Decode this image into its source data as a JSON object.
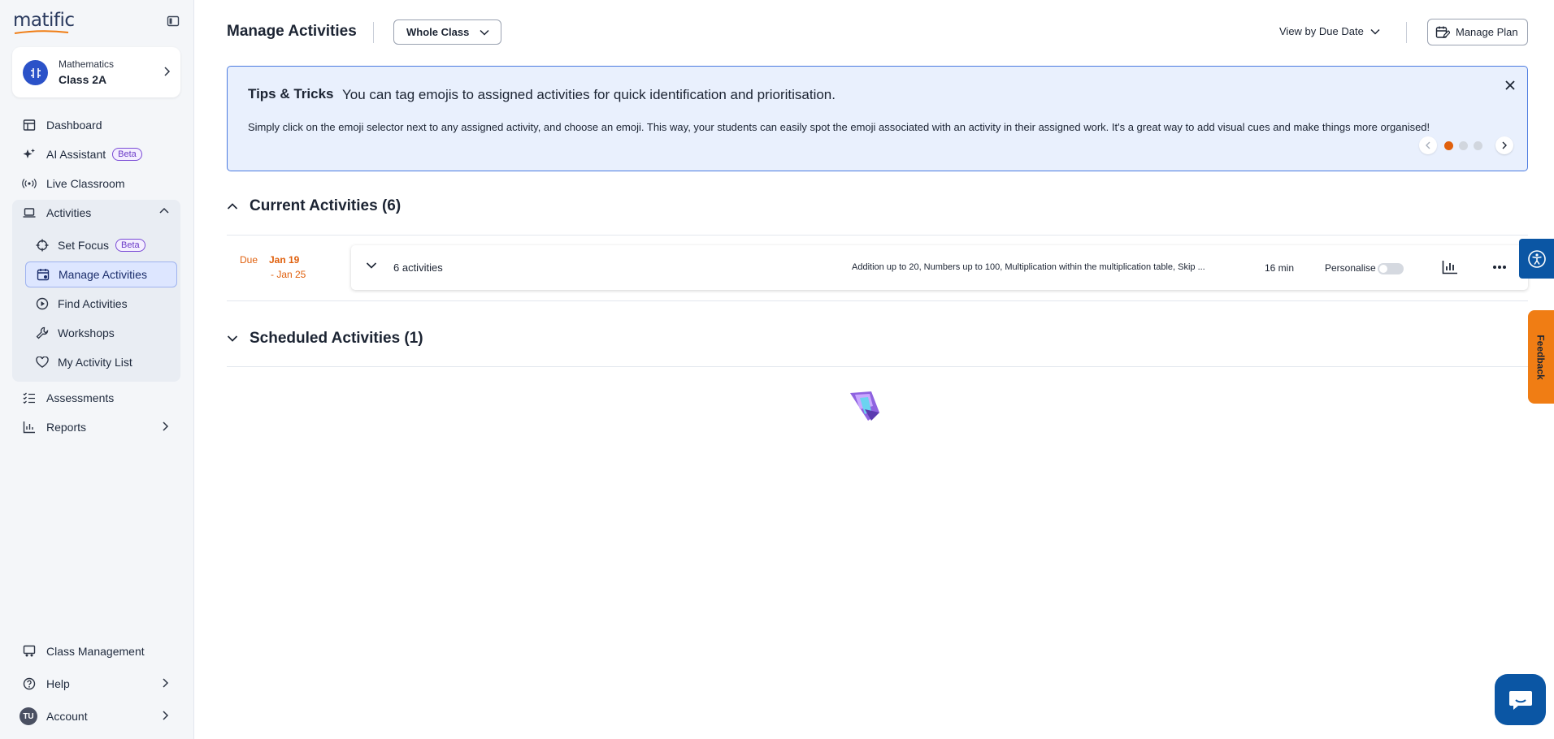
{
  "app": {
    "logo_text": "matific",
    "accent_color": "#e0600d",
    "brand_blue": "#2b52c8"
  },
  "class_card": {
    "subject": "Mathematics",
    "class_name": "Class 2A"
  },
  "nav": {
    "dashboard": "Dashboard",
    "ai_assistant": "AI Assistant",
    "ai_badge": "Beta",
    "live_classroom": "Live Classroom",
    "activities": "Activities",
    "set_focus": "Set Focus",
    "set_focus_badge": "Beta",
    "manage_activities": "Manage Activities",
    "find_activities": "Find Activities",
    "workshops": "Workshops",
    "my_activity_list": "My Activity List",
    "assessments": "Assessments",
    "reports": "Reports",
    "class_management": "Class Management",
    "help": "Help",
    "account": "Account",
    "account_initials": "TU"
  },
  "header": {
    "title": "Manage Activities",
    "group_select": "Whole Class",
    "view_by": "View by Due Date",
    "manage_plan": "Manage Plan"
  },
  "tips": {
    "title": "Tips & Tricks",
    "headline": "You can tag emojis to assigned activities for quick identification and prioritisation.",
    "body": "Simply click on the emoji selector next to any assigned activity, and choose an emoji. This way, your students can easily spot the emoji associated with an activity in their assigned work. It's a great way to add visual cues and make things more organised!",
    "slide_index": 1,
    "slide_count": 3
  },
  "current": {
    "heading": "Current Activities (6)",
    "group": {
      "due_label": "Due",
      "start_date": "Jan 19",
      "end_date": "- Jan 25",
      "count_label": "6 activities",
      "topics": "Addition up to 20, Numbers up to 100, Multiplication within the multiplication table, Skip ...",
      "duration": "16 min",
      "personalise_label": "Personalise",
      "personalise_on": false
    }
  },
  "scheduled": {
    "heading": "Scheduled Activities (1)"
  },
  "floating": {
    "feedback_label": "Feedback"
  }
}
